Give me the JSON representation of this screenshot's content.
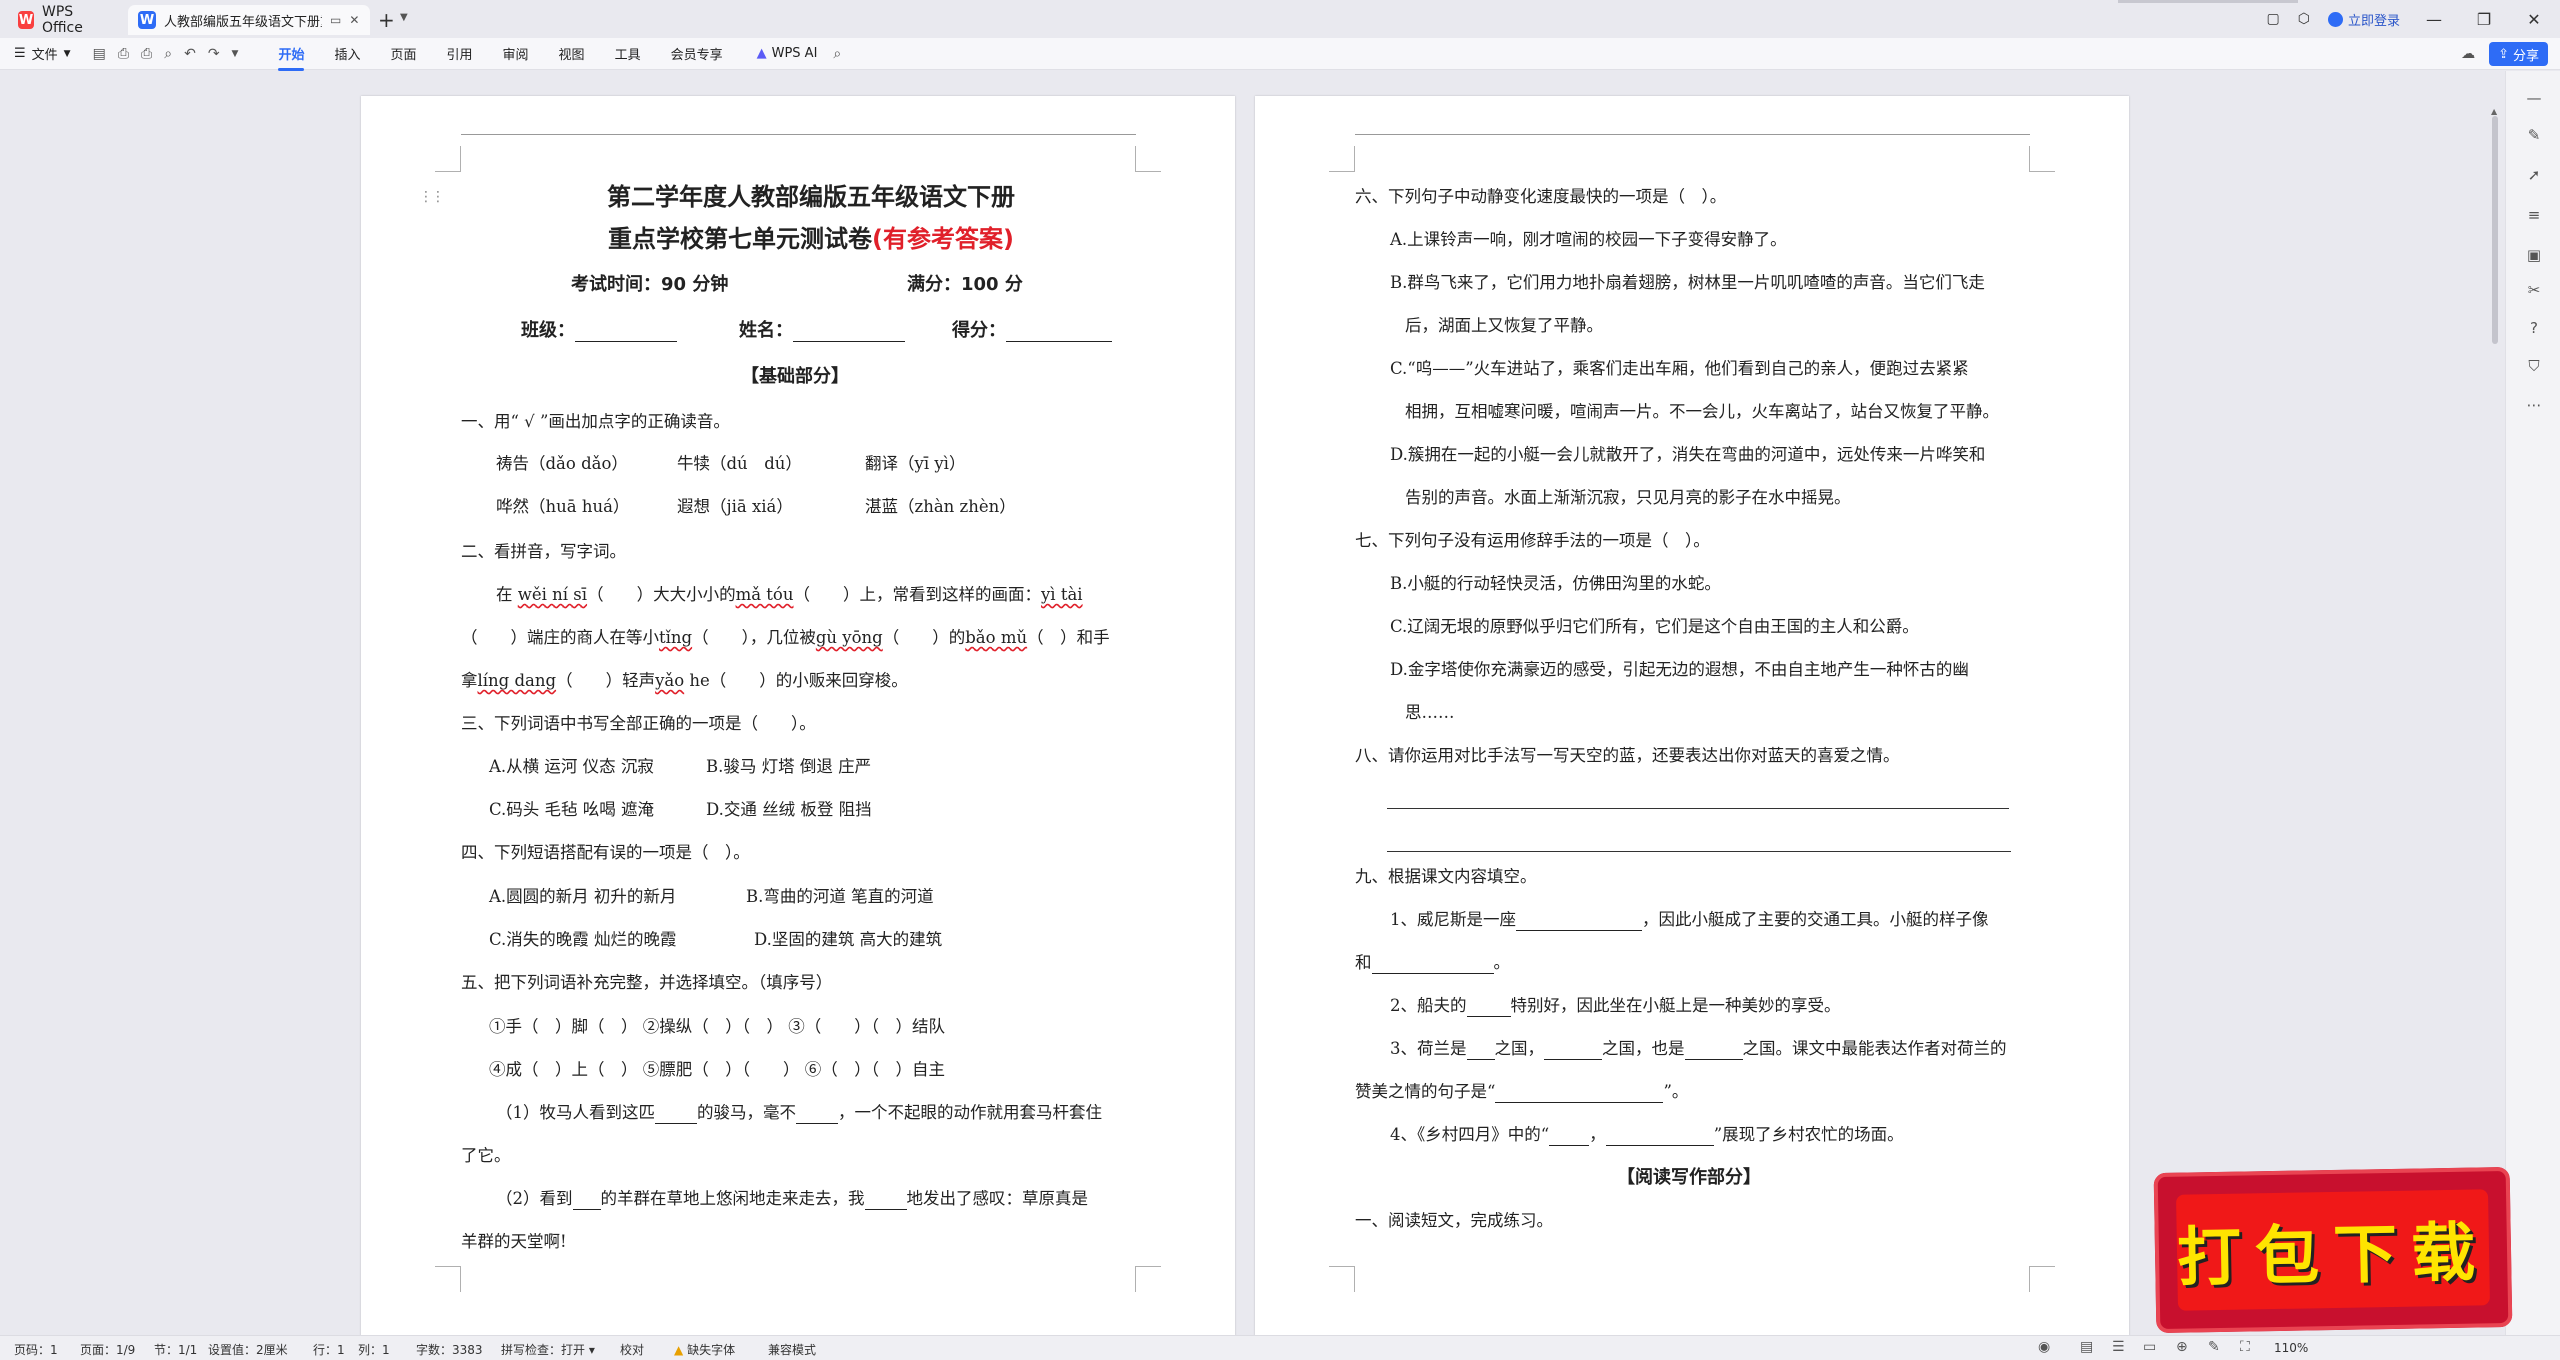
{
  "titlebar": {
    "app_tab_label": "WPS Office",
    "doc_tab_title": "人教部编版五年级语文下册重",
    "login_label": "立即登录"
  },
  "toolbar": {
    "file_label": "文件",
    "tabs": [
      "开始",
      "插入",
      "页面",
      "引用",
      "审阅",
      "视图",
      "工具",
      "会员专享"
    ],
    "ai_label": "WPS AI",
    "share_label": "分享"
  },
  "page1": {
    "title1": "第二学年度人教部编版五年级语文下册",
    "title2_main": "重点学校第七单元测试卷",
    "title2_red": "(有参考答案)",
    "exam_time": "考试时间：90 分钟",
    "full_score": "满分：100 分",
    "class_label": "班级：",
    "name_label": "姓名：",
    "score_label": "得分：",
    "section_basic": "【基础部分】",
    "q1": "一、用“ √ ”画出加点字的正确读音。",
    "q1_r1": [
      "祷告（dǎo dǎo）",
      "牛犊（dú　dú）",
      "翻译（yī yì）"
    ],
    "q1_r2": [
      "哗然（huā huá）",
      "遐想（jiā xiá）",
      "湛蓝（zhàn zhèn）"
    ],
    "q2": "二、看拼音，写字词。",
    "q2_l1a": "在",
    "q2_l1_py1": "wěi ní sī",
    "q2_l1b": "（　　）大大小小的",
    "q2_l1_py2": "mǎ tóu",
    "q2_l1c": "（　　）上，常看到这样的画面：",
    "q2_l1_py3": "yì tài",
    "q2_l2a": "（　　）端庄的商人在等小",
    "q2_l2_py1": "tǐng",
    "q2_l2b": "（　　），几位被",
    "q2_l2_py2": "gù yōng",
    "q2_l2c": "（　　）的",
    "q2_l2_py3": "bǎo mǔ",
    "q2_l2d": "（　）和手",
    "q2_l3a": "拿",
    "q2_l3_py1": "líng dang",
    "q2_l3b": "（　　）轻声",
    "q2_l3_py2": "yǎo",
    "q2_l3c": " he（　　）的小贩来回穿梭。",
    "q3": "三、下列词语中书写全部正确的一项是（　　）。",
    "q3_a": "A.从横  运河  仪态  沉寂",
    "q3_b": "B.骏马  灯塔  倒退  庄严",
    "q3_c": "C.码头  毛毡  吆喝  遮淹",
    "q3_d": "D.交通  丝绒  板登  阻挡",
    "q4": "四、下列短语搭配有误的一项是（　）。",
    "q4_a": "A.圆圆的新月    初升的新月",
    "q4_b": "B.弯曲的河道    笔直的河道",
    "q4_c": "C.消失的晚霞    灿烂的晚霞",
    "q4_d": "D.坚固的建筑    高大的建筑",
    "q5": "五、把下列词语补充完整，并选择填空。（填序号）",
    "q5_l1": "①手（　）脚（　）  ②操纵（　）（　）  ③（　　）（　）结队",
    "q5_l2": "④成（　）上（　）  ⑤膘肥（　）（　　）  ⑥（　）（　）自主",
    "q5_s1a": "（1）牧马人看到这匹",
    "q5_s1b": "的骏马，毫不",
    "q5_s1c": "，一个不起眼的动作就用套马杆套住",
    "q5_s1d": "了它。",
    "q5_s2a": "（2）看到",
    "q5_s2b": "的羊群在草地上悠闲地走来走去，我",
    "q5_s2c": "地发出了感叹：草原真是",
    "q5_s2d": "羊群的天堂啊!"
  },
  "page2": {
    "q6": "六、下列句子中动静变化速度最快的一项是（　）。",
    "q6_a": "A.上课铃声一响，刚才喧闹的校园一下子变得安静了。",
    "q6_b1": "B.群鸟飞来了，它们用力地扑扇着翅膀，树林里一片叽叽喳喳的声音。当它们飞走",
    "q6_b2": "后，湖面上又恢复了平静。",
    "q6_c1": "C.“呜——”火车进站了，乘客们走出车厢，他们看到自己的亲人，便跑过去紧紧",
    "q6_c2": "相拥，互相嘘寒问暖，喧闹声一片。不一会儿，火车离站了，站台又恢复了平静。",
    "q6_d1": "D.簇拥在一起的小艇一会儿就散开了，消失在弯曲的河道中，远处传来一片哗笑和",
    "q6_d2": "告别的声音。水面上渐渐沉寂，只见月亮的影子在水中摇晃。",
    "q7": "七、下列句子没有运用修辞手法的一项是（　）。",
    "q7_b": "B.小艇的行动轻快灵活，仿佛田沟里的水蛇。",
    "q7_c": "C.辽阔无垠的原野似乎归它们所有，它们是这个自由王国的主人和公爵。",
    "q7_d1": "D.金字塔使你充满豪迈的感受，引起无边的遐想，不由自主地产生一种怀古的幽",
    "q7_d2": "思……",
    "q8": "八、请你运用对比手法写一写天空的蓝，还要表达出你对蓝天的喜爱之情。",
    "q9": "九、根据课文内容填空。",
    "q9_1a": "1、威尼斯是一座",
    "q9_1b": "，因此小艇成了主要的交通工具。小艇的样子像",
    "q9_1c": "和",
    "q9_1d": "。",
    "q9_2a": "2、船夫的",
    "q9_2b": "特别好，因此坐在小艇上是一种美妙的享受。",
    "q9_3a": "3、荷兰是",
    "q9_3b": "之国，",
    "q9_3c": "之国，也是",
    "q9_3d": "之国。课文中最能表达作者对荷兰的",
    "q9_3e": "赞美之情的句子是“",
    "q9_3f": "”。",
    "q9_4a": "4、《乡村四月》中的“",
    "q9_4b": "，",
    "q9_4c": "”展现了乡村农忙的场面。",
    "section_read": "【阅读写作部分】",
    "r1": "一、阅读短文，完成练习。"
  },
  "statusbar": {
    "page_num": "页码：1",
    "page_of": "页面：1/9",
    "section": "节：1/1",
    "setting": "设置值：2厘米",
    "row": "行：1",
    "col": "列：1",
    "word_count": "字数：3383",
    "spell": "拼写检查：打开",
    "proof": "校对",
    "missing_font": "缺失字体",
    "compat": "兼容模式",
    "zoom": "110%"
  },
  "overlay": {
    "download_text": "打包下载"
  },
  "colors": {
    "accent": "#2e6cf6",
    "red_answer": "#e0202a",
    "download_bg": "#f01818",
    "download_text": "#ffe400"
  }
}
